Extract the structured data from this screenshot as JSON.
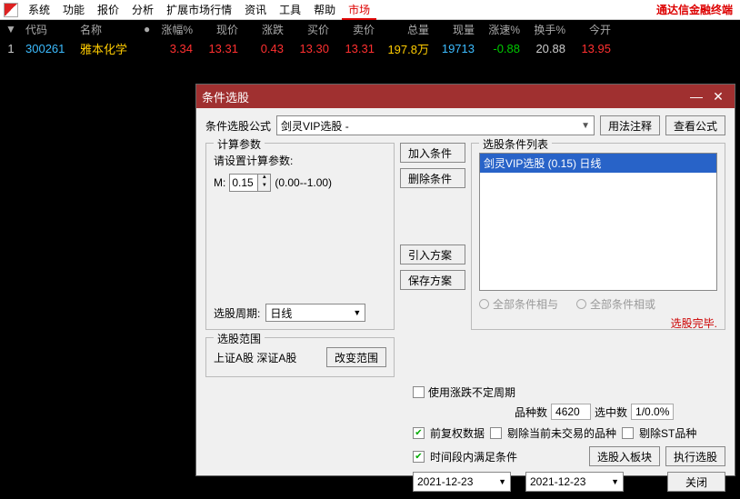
{
  "menu": {
    "items": [
      "系统",
      "功能",
      "报价",
      "分析",
      "扩展市场行情",
      "资讯",
      "工具",
      "帮助",
      "市场"
    ],
    "selected_index": 8,
    "brand": "通达信金融终端"
  },
  "table": {
    "headers": [
      "",
      "代码",
      "名称",
      "",
      "涨幅%",
      "现价",
      "涨跌",
      "买价",
      "卖价",
      "总量",
      "现量",
      "涨速%",
      "换手%",
      "今开"
    ],
    "row": {
      "idx": "1",
      "code": "300261",
      "name": "雅本化学",
      "pct": "3.34",
      "price": "13.31",
      "chg": "0.43",
      "bid": "13.30",
      "ask": "13.31",
      "vol": "197.8万",
      "cur": "19713",
      "spd": "-0.88",
      "turn": "20.88",
      "open": "13.95"
    }
  },
  "dialog": {
    "title": "条件选股",
    "formula_label": "条件选股公式",
    "formula_value": "剑灵VIP选股  -",
    "btn_usage": "用法注释",
    "btn_view": "查看公式",
    "calc_legend": "计算参数",
    "calc_hint": "请设置计算参数:",
    "m_label": "M:",
    "m_value": "0.15",
    "m_range": "(0.00--1.00)",
    "period_label": "选股周期:",
    "period_value": "日线",
    "btn_add": "加入条件",
    "btn_del": "删除条件",
    "btn_import": "引入方案",
    "btn_save": "保存方案",
    "list_legend": "选股条件列表",
    "list_item": "剑灵VIP选股 (0.15) 日线",
    "radio_and": "全部条件相与",
    "radio_or": "全部条件相或",
    "done": "选股完毕.",
    "scope_legend": "选股范围",
    "scope_text": "上证A股 深证A股",
    "btn_scope": "改变范围",
    "chk_irregular": "使用涨跌不定周期",
    "stat_kind": "品种数",
    "stat_kind_v": "4620",
    "stat_sel": "选中数",
    "stat_sel_v": "1/0.0%",
    "chk_fq": "前复权数据",
    "chk_excl": "剔除当前未交易的品种",
    "chk_st": "剔除ST品种",
    "chk_time": "时间段内满足条件",
    "btn_block": "选股入板块",
    "btn_run": "执行选股",
    "date_from": "2021-12-23",
    "date_to": "2021-12-23",
    "dash": "-",
    "btn_close": "关闭"
  }
}
